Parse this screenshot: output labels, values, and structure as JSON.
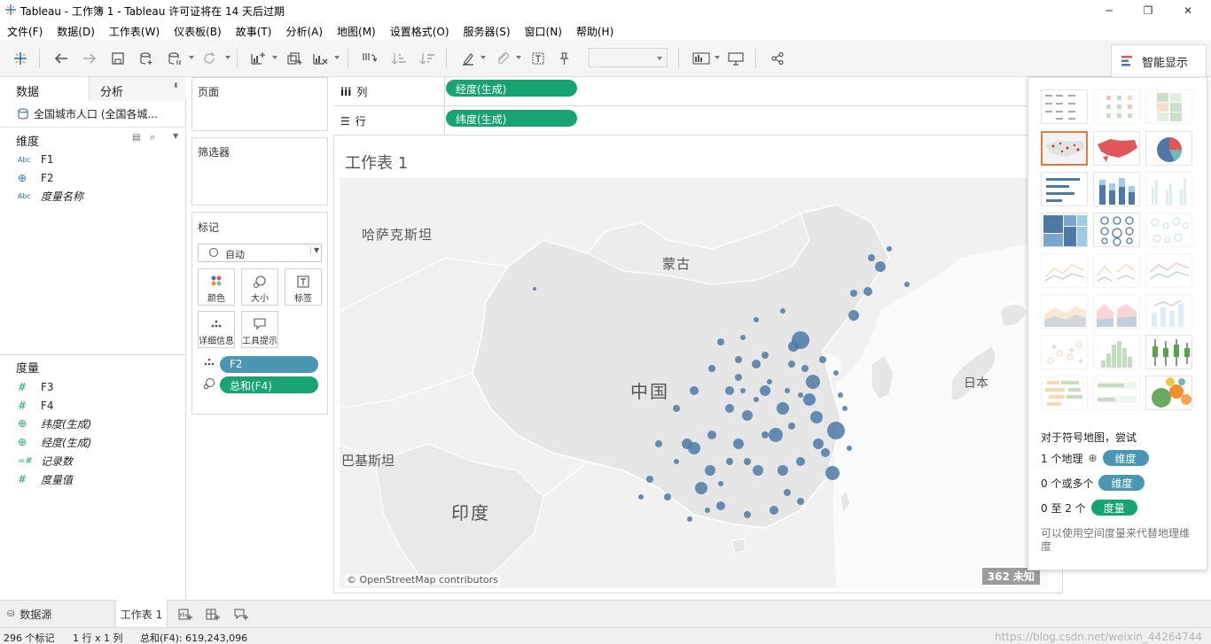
{
  "app": {
    "title": "Tableau - 工作簿 1 - Tableau 许可证将在 14 天后过期",
    "window_controls": {
      "minimize": "─",
      "maximize": "❐",
      "close": "✕"
    }
  },
  "menu": [
    "文件(F)",
    "数据(D)",
    "工作表(W)",
    "仪表板(B)",
    "故事(T)",
    "分析(A)",
    "地图(M)",
    "设置格式(O)",
    "服务器(S)",
    "窗口(N)",
    "帮助(H)"
  ],
  "toolbar": {
    "show_me_label": "智能显示"
  },
  "left_panel": {
    "tab_data": "数据",
    "tab_analysis": "分析",
    "datasource": "全国城市人口 (全国各城...",
    "dimensions_header": "维度",
    "dimensions": [
      {
        "icon": "Abc",
        "label": "F1",
        "italic": false
      },
      {
        "icon": "⊕",
        "label": "F2",
        "italic": false
      },
      {
        "icon": "Abc",
        "label": "度量名称",
        "italic": true
      }
    ],
    "measures_header": "度量",
    "measures": [
      {
        "icon": "#",
        "label": "F3",
        "italic": false
      },
      {
        "icon": "#",
        "label": "F4",
        "italic": false
      },
      {
        "icon": "⊕",
        "label": "纬度(生成)",
        "italic": true
      },
      {
        "icon": "⊕",
        "label": "经度(生成)",
        "italic": true
      },
      {
        "icon": "=#",
        "label": "记录数",
        "italic": true
      },
      {
        "icon": "#",
        "label": "度量值",
        "italic": true
      }
    ]
  },
  "cards": {
    "pages": "页面",
    "filters": "筛选器",
    "marks": "标记",
    "mark_type": "自动",
    "mark_buttons": [
      "颜色",
      "大小",
      "标签",
      "详细信息",
      "工具提示"
    ],
    "mark_pills": [
      {
        "label": "F2",
        "color": "#4a96b3"
      },
      {
        "label": "总和(F4)",
        "color": "#17a472"
      }
    ]
  },
  "shelves": {
    "columns_label": "列",
    "columns_pill": "经度(生成)",
    "rows_label": "行",
    "rows_pill": "纬度(生成)"
  },
  "view": {
    "title": "工作表 1",
    "map_labels": [
      "哈萨克斯坦",
      "蒙古",
      "中国",
      "日本",
      "巴基斯坦",
      "印度"
    ],
    "attribution": "© OpenStreetMap contributors",
    "unknown_badge": "362 未知",
    "mark_color": "#4e79a7"
  },
  "show_me": {
    "hint_title": "对于符号地图，尝试",
    "hint_rows": [
      {
        "prefix": "1 个地理",
        "pill": "维度",
        "color": "#4a96b3"
      },
      {
        "prefix": "0 个或多个",
        "pill": "维度",
        "color": "#4a96b3"
      },
      {
        "prefix": "0 至 2 个",
        "pill": "度量",
        "color": "#17a472"
      }
    ],
    "hint_note": "可以使用空间度量来代替地理维度"
  },
  "bottom_tabs": {
    "datasource": "数据源",
    "sheet": "工作表 1"
  },
  "status": {
    "marks": "296 个标记",
    "rows_cols": "1 行 x 1 列",
    "sum": "总和(F4): 619,243,096",
    "watermark": "https://blog.csdn.net/weixin_44264744"
  }
}
